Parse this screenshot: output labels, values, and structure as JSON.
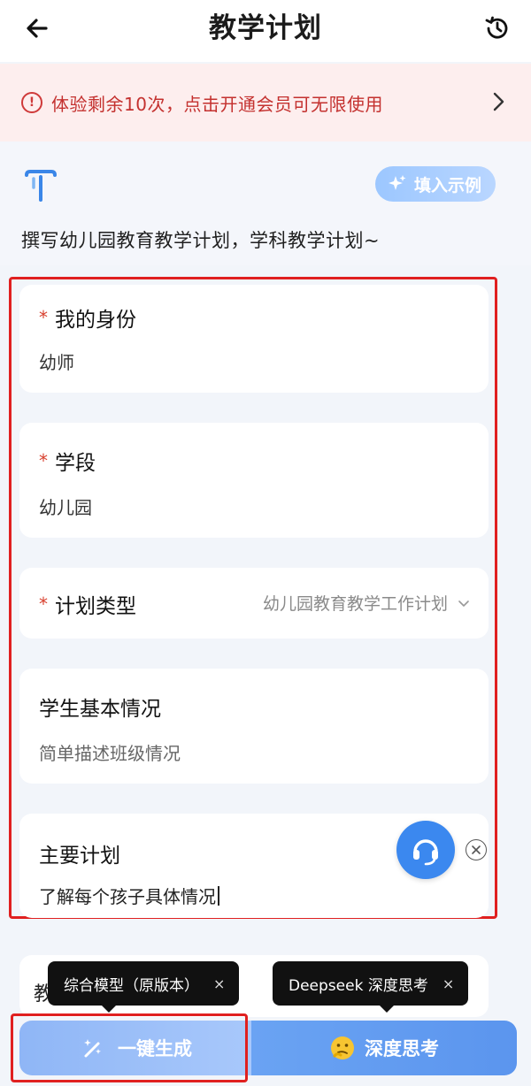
{
  "header": {
    "title": "教学计划",
    "back_icon": "arrow-left-icon",
    "history_icon": "history-icon"
  },
  "banner": {
    "icon": "exclamation-circle-icon",
    "text": "体验剩余10次，点击开通会员可无限使用",
    "chevron_icon": "chevron-right-icon",
    "color": "#c4312f"
  },
  "intro": {
    "logo_icon": "brand-logo-icon",
    "fill_example_label": "填入示例",
    "description": "撰写幼儿园教育教学计划，学科教学计划~"
  },
  "form": {
    "identity": {
      "required_mark": "*",
      "label": "我的身份",
      "value": "幼师"
    },
    "stage": {
      "required_mark": "*",
      "label": "学段",
      "value": "幼儿园"
    },
    "plan_type": {
      "required_mark": "*",
      "label": "计划类型",
      "selected": "幼儿园教育教学工作计划"
    },
    "student_info": {
      "label": "学生基本情况",
      "placeholder": "简单描述班级情况"
    },
    "main_plan": {
      "label": "主要计划",
      "value": "了解每个孩子具体情况"
    },
    "next_partial": "教"
  },
  "tooltips": {
    "generate_tip": "综合模型（原版本）",
    "deep_tip": "Deepseek 深度思考",
    "close_symbol": "×"
  },
  "actions": {
    "generate_label": "一键生成",
    "deep_label": "深度思考",
    "accent": "#5b95ee"
  }
}
